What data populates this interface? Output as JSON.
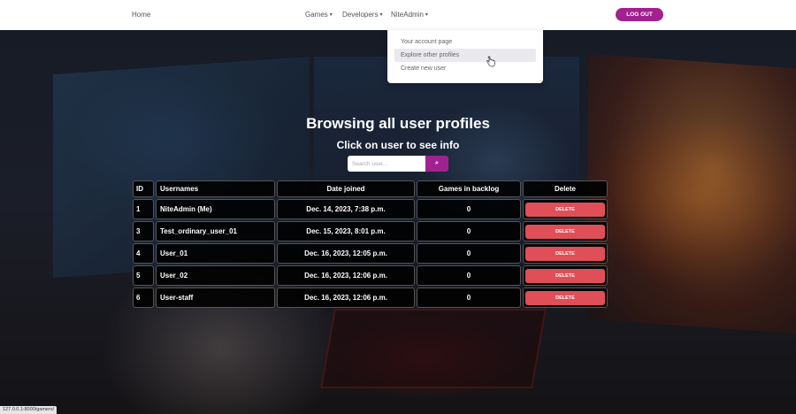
{
  "nav": {
    "home": "Home",
    "games": "Games",
    "developers": "Developers",
    "user": "NiteAdmin",
    "logout": "LOG OUT"
  },
  "dropdown": {
    "items": [
      "Your account page",
      "Explore other profiles",
      "Create new user"
    ],
    "hovered_index": 1
  },
  "hero": {
    "title": "Browsing all user profiles",
    "subtitle": "Click on user to see info"
  },
  "search": {
    "placeholder": "Search user...",
    "button": "⌕"
  },
  "table": {
    "headers": [
      "ID",
      "Usernames",
      "Date joined",
      "Games in backlog",
      "Delete"
    ],
    "rows": [
      {
        "id": "1",
        "username": "NiteAdmin (Me)",
        "date": "Dec. 14, 2023, 7:38 p.m.",
        "games": "0",
        "action": "DELETE"
      },
      {
        "id": "3",
        "username": "Test_ordinary_user_01",
        "date": "Dec. 15, 2023, 8:01 p.m.",
        "games": "0",
        "action": "DELETE"
      },
      {
        "id": "4",
        "username": "User_01",
        "date": "Dec. 16, 2023, 12:05 p.m.",
        "games": "0",
        "action": "DELETE"
      },
      {
        "id": "5",
        "username": "User_02",
        "date": "Dec. 16, 2023, 12:06 p.m.",
        "games": "0",
        "action": "DELETE"
      },
      {
        "id": "6",
        "username": "User-staff",
        "date": "Dec. 16, 2023, 12:06 p.m.",
        "games": "0",
        "action": "DELETE"
      }
    ]
  },
  "status_bar": "127.0.0.1:8000/gamers/",
  "colors": {
    "accent": "#a1228e",
    "delete": "#e04f57"
  }
}
